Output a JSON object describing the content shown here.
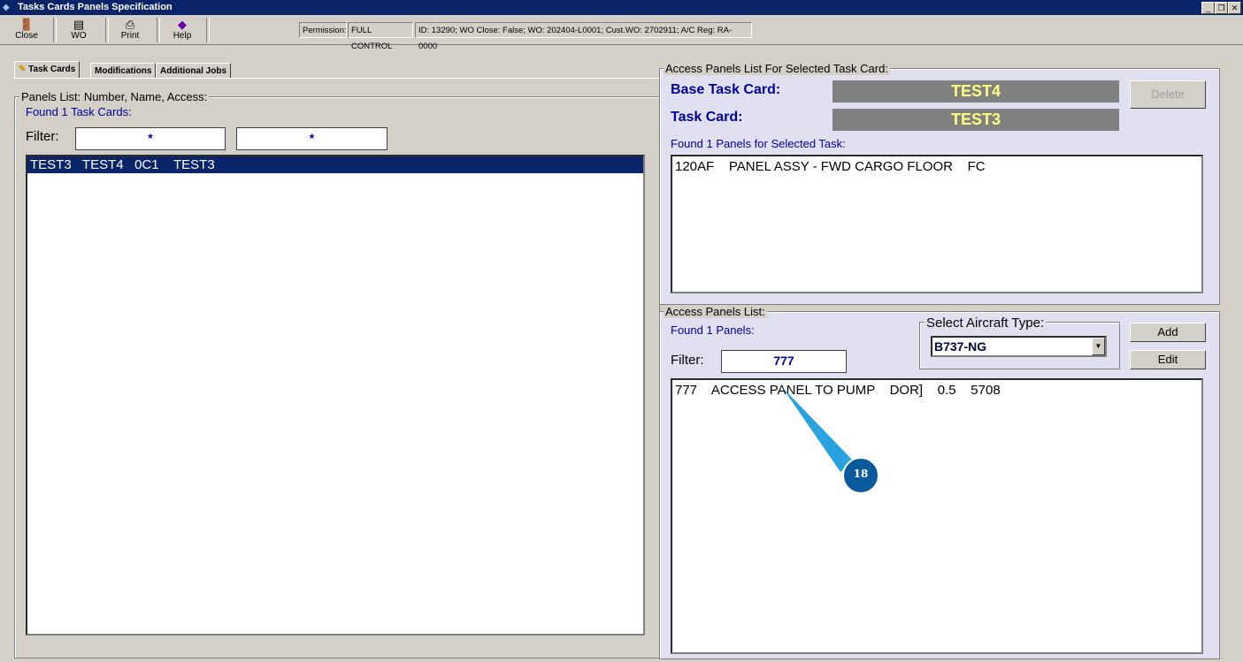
{
  "window": {
    "title": "Tasks Cards Panels Specification"
  },
  "toolbar": {
    "close": "Close",
    "wo": "WO",
    "print": "Print",
    "help": "Help"
  },
  "status": {
    "permission_label": "Permission:",
    "permission": "FULL CONTROL",
    "info": "ID: 13290; WO Close: False; WO: 202404-L0001; Cust.WO: 2702911; A/C Reg: RA-0000"
  },
  "tabs": [
    "Task Cards",
    "Modifications",
    "Additional Jobs"
  ],
  "left": {
    "group_title": "Panels List: Number, Name, Access:",
    "found": "Found 1 Task Cards:",
    "filter_label": "Filter:",
    "filter1": "*",
    "filter2": "*",
    "rows": [
      "TEST3   TEST4   0C1    TEST3"
    ]
  },
  "upper": {
    "group_title": "Access Panels List For Selected Task Card:",
    "base_label": "Base Task Card:",
    "base_value": "TEST4",
    "tc_label": "Task Card:",
    "tc_value": "TEST3",
    "delete": "Delete",
    "found": "Found 1 Panels for Selected Task:",
    "rows": [
      "120AF    PANEL ASSY - FWD CARGO FLOOR    FC"
    ]
  },
  "lower": {
    "group_title": "Access Panels List:",
    "found": "Found 1 Panels:",
    "filter_label": "Filter:",
    "filter": "777",
    "aircraft_label": "Select Aircraft Type:",
    "aircraft": "B737-NG",
    "add": "Add",
    "edit": "Edit",
    "rows": [
      "777    ACCESS PANEL TO PUMP    DOR]    0.5    5708"
    ]
  },
  "callout": "18"
}
